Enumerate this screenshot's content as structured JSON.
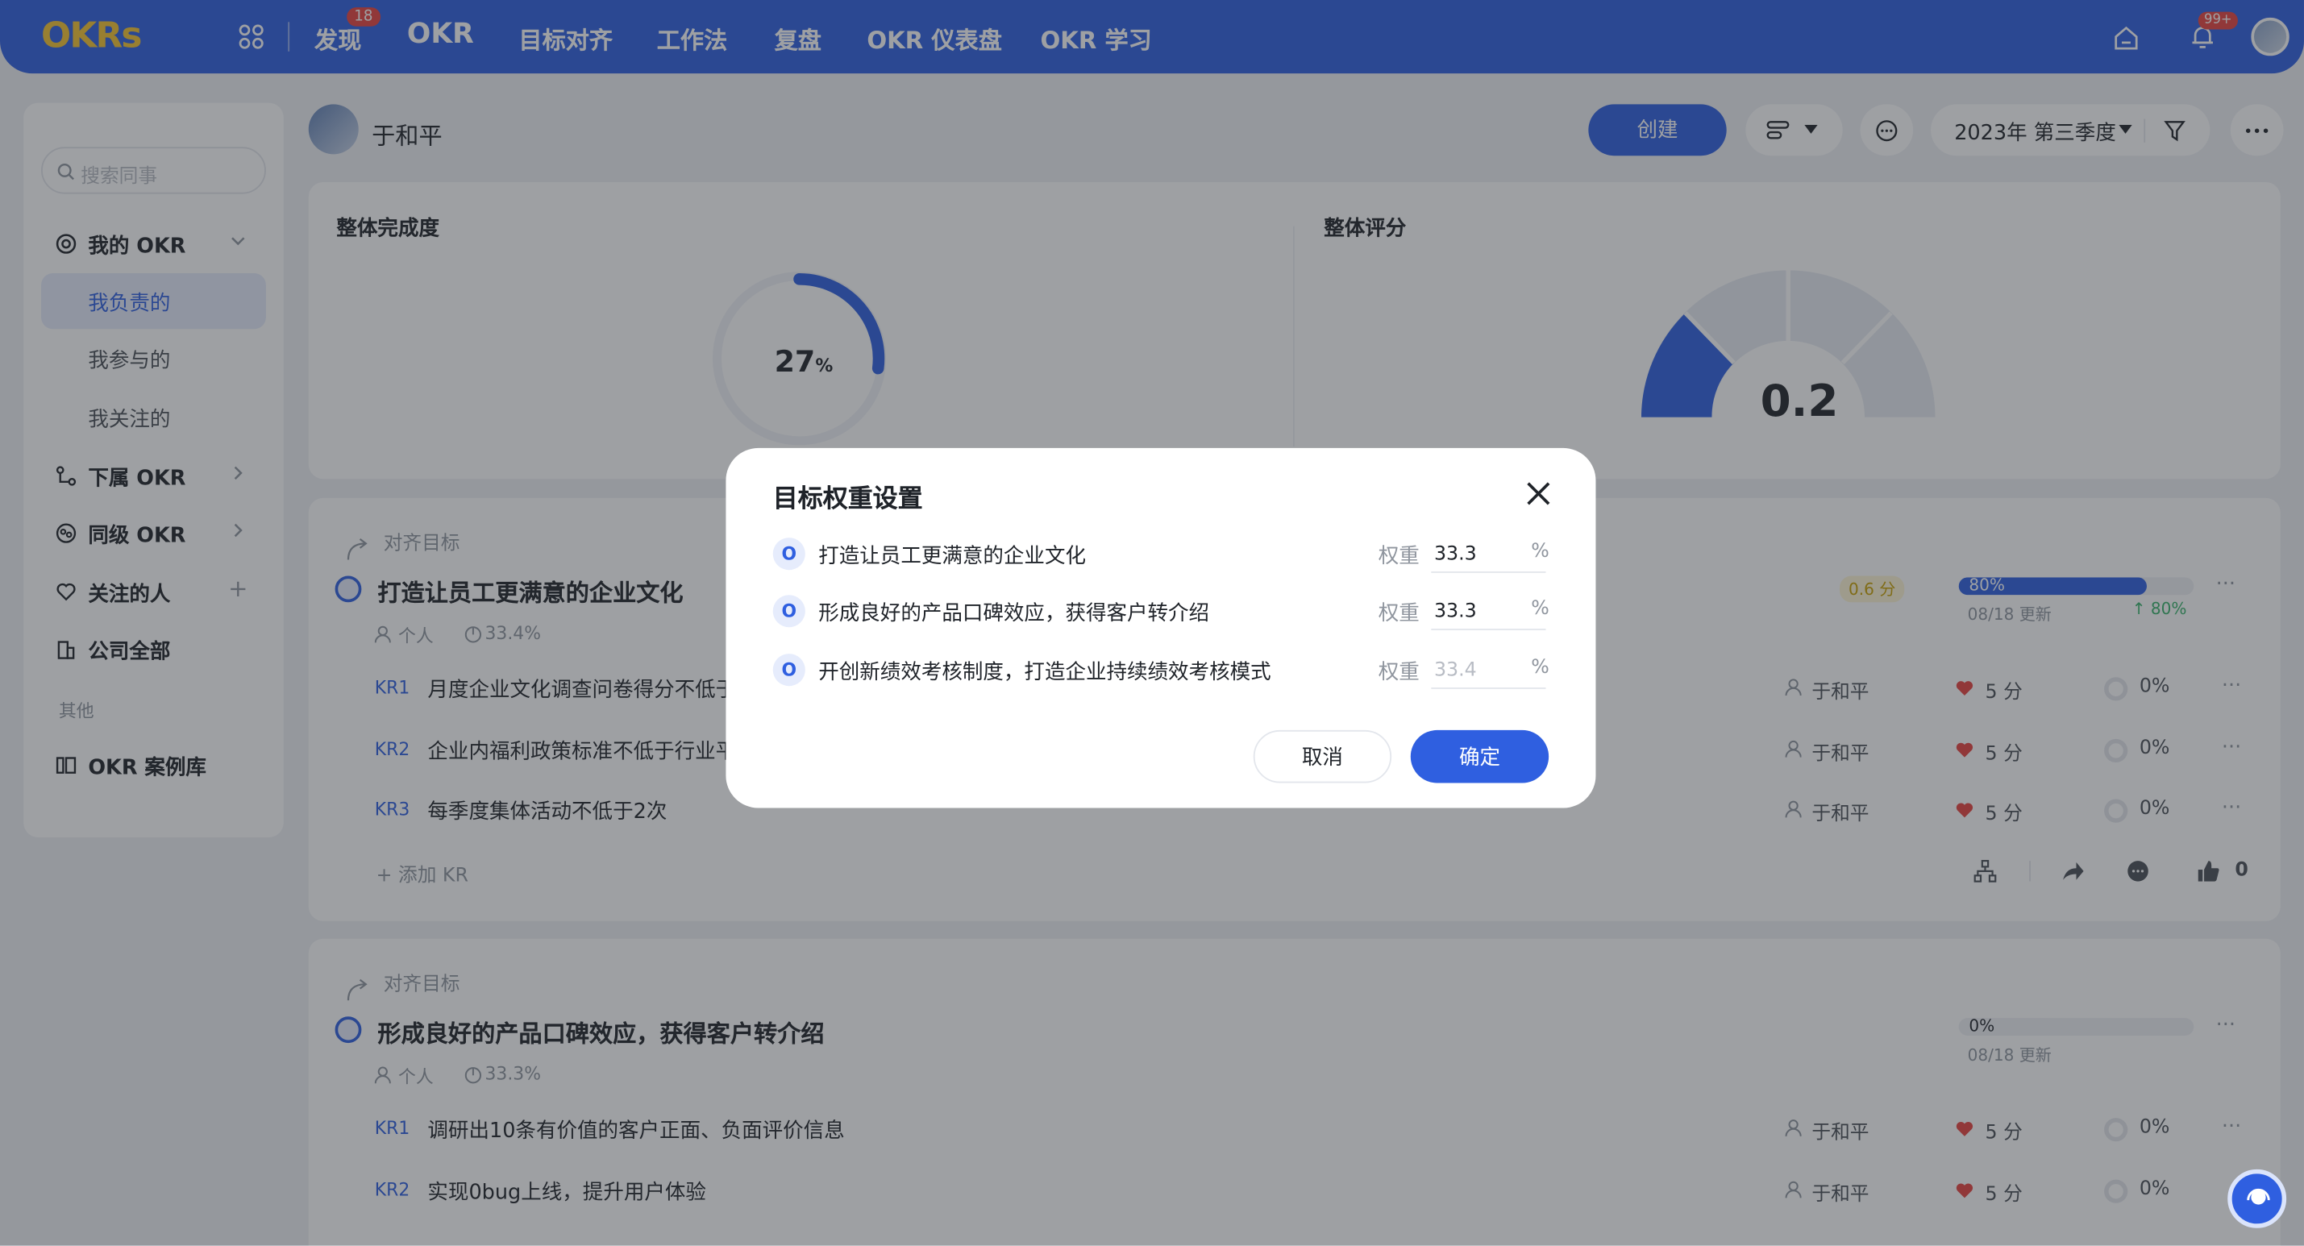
{
  "topnav": {
    "logo": "OKRs",
    "items": [
      "发现",
      "OKR",
      "目标对齐",
      "工作法",
      "复盘",
      "OKR 仪表盘",
      "OKR 学习"
    ],
    "discover_badge": "18",
    "bell_badge": "99+"
  },
  "sidebar": {
    "search_placeholder": "搜索同事",
    "my_okr": "我的 OKR",
    "sub_items": [
      "我负责的",
      "我参与的",
      "我关注的"
    ],
    "subordinate_okr": "下属 OKR",
    "peer_okr": "同级 OKR",
    "followed_people": "关注的人",
    "company_all": "公司全部",
    "other_label": "其他",
    "case_library": "OKR 案例库"
  },
  "header": {
    "user_name": "于和平",
    "create_label": "创建",
    "quarter": "2023年 第三季度"
  },
  "overview": {
    "completion_title": "整体完成度",
    "completion_value": "27",
    "completion_unit": "%",
    "completion_fraction": 0.27,
    "score_title": "整体评分",
    "score_value": "0.2"
  },
  "objectives": [
    {
      "align_label": "对齐目标",
      "title": "打造让员工更满意的企业文化",
      "type": "个人",
      "weight": "33.4%",
      "score": "0.6 分",
      "progress": "80%",
      "progress_fraction": 0.8,
      "updated": "08/18 更新",
      "trend": "↑ 80%",
      "krs": [
        {
          "tag": "KR1",
          "text": "月度企业文化调查问卷得分不低于",
          "owner": "于和平",
          "score": "5 分",
          "pct": "0%"
        },
        {
          "tag": "KR2",
          "text": "企业内福利政策标准不低于行业平",
          "owner": "于和平",
          "score": "5 分",
          "pct": "0%"
        },
        {
          "tag": "KR3",
          "text": "每季度集体活动不低于2次",
          "owner": "于和平",
          "score": "5 分",
          "pct": "0%"
        }
      ],
      "add_kr": "添加 KR",
      "likes": "0"
    },
    {
      "align_label": "对齐目标",
      "title": "形成良好的产品口碑效应，获得客户转介绍",
      "type": "个人",
      "weight": "33.3%",
      "progress": "0%",
      "progress_fraction": 0,
      "updated": "08/18 更新",
      "krs": [
        {
          "tag": "KR1",
          "text": "调研出10条有价值的客户正面、负面评价信息",
          "owner": "于和平",
          "score": "5 分",
          "pct": "0%"
        },
        {
          "tag": "KR2",
          "text": "实现0bug上线，提升用户体验",
          "owner": "于和平",
          "score": "5 分",
          "pct": "0%"
        }
      ]
    }
  ],
  "modal": {
    "title": "目标权重设置",
    "weight_label": "权重",
    "unit": "%",
    "rows": [
      {
        "badge": "O",
        "text": "打造让员工更满意的企业文化",
        "value": "33.3",
        "placeholder": ""
      },
      {
        "badge": "O",
        "text": "形成良好的产品口碑效应，获得客户转介绍",
        "value": "33.3",
        "placeholder": ""
      },
      {
        "badge": "O",
        "text": "开创新绩效考核制度，打造企业持续绩效考核模式",
        "value": "",
        "placeholder": "33.4"
      }
    ],
    "cancel_label": "取消",
    "ok_label": "确定"
  },
  "colors": {
    "primary": "#2f5fe0",
    "nav_bg": "#2f5fe0",
    "badge_red": "#e8433f"
  }
}
